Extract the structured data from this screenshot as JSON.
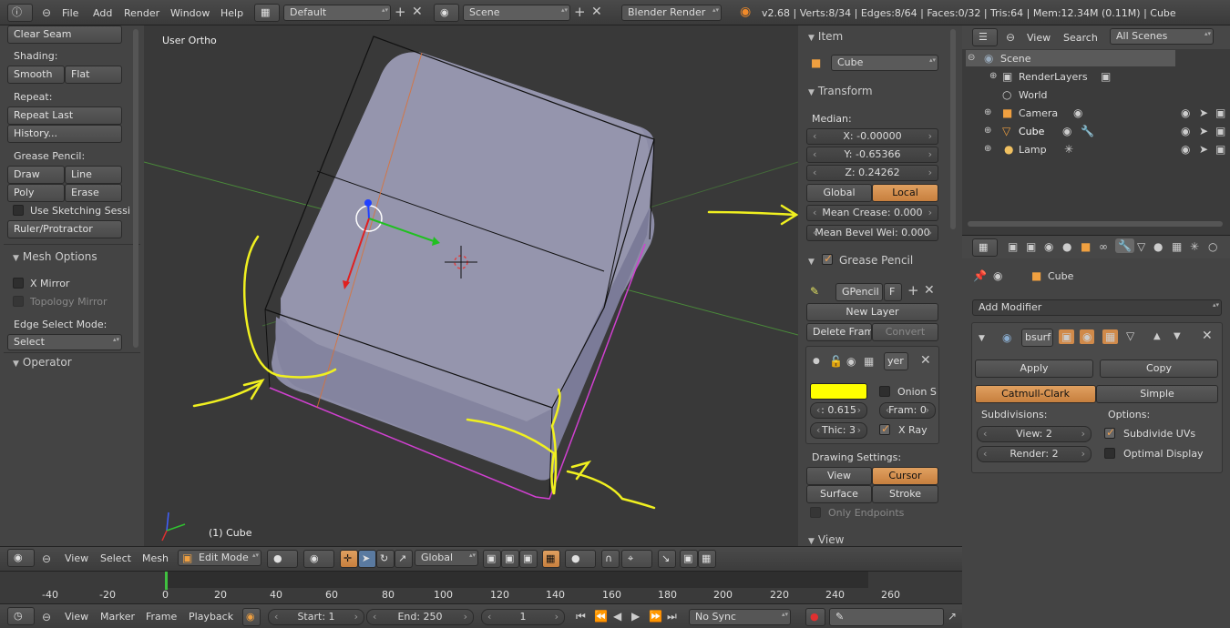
{
  "topbar": {
    "menus": [
      "File",
      "Add",
      "Render",
      "Window",
      "Help"
    ],
    "layout": "Default",
    "scene": "Scene",
    "engine": "Blender Render",
    "stats": "v2.68 | Verts:8/34 | Edges:8/64 | Faces:0/32 | Tris:64 | Mem:12.34M (0.11M) | Cube"
  },
  "toolshelf": {
    "clear_seam": "Clear Seam",
    "shading_label": "Shading:",
    "smooth": "Smooth",
    "flat": "Flat",
    "repeat_label": "Repeat:",
    "repeat_last": "Repeat Last",
    "history": "History...",
    "grease_label": "Grease Pencil:",
    "draw": "Draw",
    "line": "Line",
    "poly": "Poly",
    "erase": "Erase",
    "use_sketching": "Use Sketching Sessi",
    "ruler": "Ruler/Protractor",
    "mesh_options": "Mesh Options",
    "x_mirror": "X Mirror",
    "topology_mirror": "Topology Mirror",
    "edge_select_label": "Edge Select Mode:",
    "edge_select_value": "Select",
    "operator": "Operator"
  },
  "viewport": {
    "view_label": "User Ortho",
    "object_label": "(1) Cube",
    "colors": {
      "bg": "#393939",
      "grid_green": "#4a8a3a",
      "grid_red": "#a04040",
      "mesh": "#8f8fa8",
      "annotation": "#f0f020"
    }
  },
  "properties": {
    "item_header": "Item",
    "item_name": "Cube",
    "transform_header": "Transform",
    "median_label": "Median:",
    "x": "X: -0.00000",
    "y": "Y: -0.65366",
    "z": "Z: 0.24262",
    "global": "Global",
    "local": "Local",
    "mean_crease": "Mean Crease: 0.000",
    "mean_bevel": "Mean Bevel Wei: 0.000",
    "grease_header": "Grease Pencil",
    "gpencil": "GPencil",
    "f_label": "F",
    "new_layer": "New Layer",
    "delete_frame": "Delete Frame",
    "convert": "Convert",
    "layer_name": "yer",
    "color_hex": "#ffff00",
    "opacity": ": 0.615",
    "onion": "Onion S",
    "frame": "Fram: 0",
    "thickness": "Thic: 3",
    "xray": "X Ray",
    "drawing_settings": "Drawing Settings:",
    "view_btn": "View",
    "cursor_btn": "Cursor",
    "surface_btn": "Surface",
    "stroke_btn": "Stroke",
    "only_endpoints": "Only Endpoints",
    "view_header": "View"
  },
  "outliner": {
    "menus": [
      "View",
      "Search"
    ],
    "filter": "All Scenes",
    "items": [
      "Scene",
      "RenderLayers",
      "World",
      "Camera",
      "Cube",
      "Lamp"
    ]
  },
  "modifiers": {
    "object_name": "Cube",
    "add_modifier": "Add Modifier",
    "mod_name": "bsurf",
    "apply": "Apply",
    "copy": "Copy",
    "catmull": "Catmull-Clark",
    "simple": "Simple",
    "subdivisions_label": "Subdivisions:",
    "options_label": "Options:",
    "view_levels": "View: 2",
    "render_levels": "Render: 2",
    "subdivide_uvs": "Subdivide UVs",
    "optimal_display": "Optimal Display"
  },
  "viewport_header": {
    "menus": [
      "View",
      "Select",
      "Mesh"
    ],
    "mode": "Edit Mode",
    "orientation": "Global"
  },
  "timeline": {
    "ticks": [
      "-40",
      "-20",
      "0",
      "20",
      "40",
      "60",
      "80",
      "100",
      "120",
      "140",
      "160",
      "180",
      "200",
      "220",
      "240",
      "260"
    ],
    "menus": [
      "View",
      "Marker",
      "Frame",
      "Playback"
    ],
    "start": "Start: 1",
    "end": "End: 250",
    "current": "1",
    "sync": "No Sync"
  }
}
